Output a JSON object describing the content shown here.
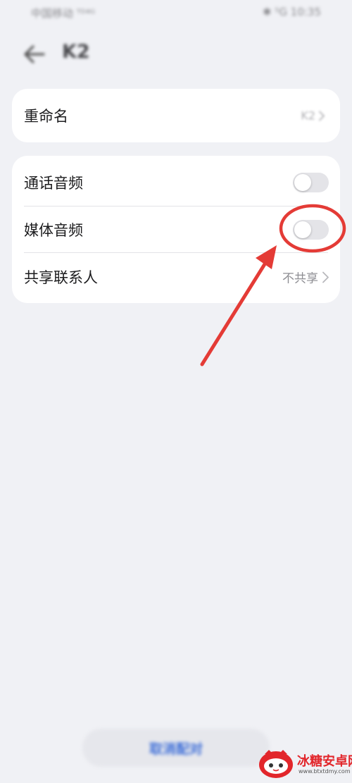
{
  "status_bar": {
    "left_text": "中国移动 ᵀᴰ⁴ᴳ",
    "right_text": "✱ ⁵G 10:35"
  },
  "header": {
    "title": "K2"
  },
  "settings": {
    "rename": {
      "label": "重命名",
      "value": "K2"
    },
    "call_audio": {
      "label": "通话音频",
      "enabled": false
    },
    "media_audio": {
      "label": "媒体音频",
      "enabled": false
    },
    "share_contacts": {
      "label": "共享联系人",
      "value": "不共享"
    }
  },
  "bottom_button": {
    "label": "取消配对"
  },
  "watermark": {
    "name": "冰糖安卓网",
    "url": "www.btxtdmy.com"
  },
  "colors": {
    "annotation": "#e43b36",
    "background": "#f0f1f5",
    "card": "#ffffff",
    "toggle_off": "#e4e4e8",
    "accent": "#3f6fd8"
  }
}
